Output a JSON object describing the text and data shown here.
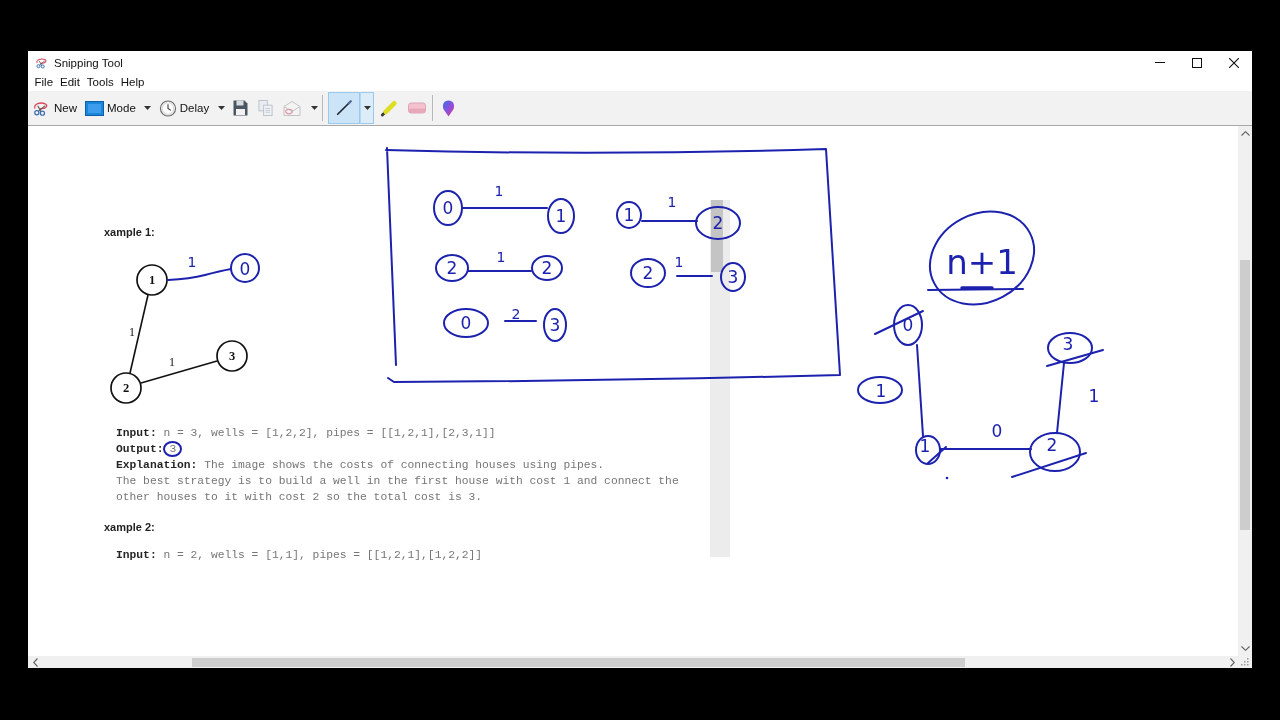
{
  "window": {
    "title": "Snipping Tool"
  },
  "menu": [
    {
      "label": "File"
    },
    {
      "label": "Edit"
    },
    {
      "label": "Tools"
    },
    {
      "label": "Help"
    }
  ],
  "toolbar": {
    "buttons": [
      {
        "kind": "new",
        "label": "New",
        "dropdown": false
      },
      {
        "kind": "mode",
        "label": "Mode",
        "dropdown": true
      },
      {
        "kind": "delay",
        "label": "Delay",
        "dropdown": true
      }
    ],
    "actions": [
      {
        "kind": "save",
        "disabled": false,
        "dropdown": false
      },
      {
        "kind": "copy",
        "disabled": true,
        "dropdown": false
      },
      {
        "kind": "send",
        "disabled": true,
        "dropdown": true
      }
    ],
    "tools": [
      {
        "kind": "pen",
        "selected": true,
        "dropdown": true
      },
      {
        "kind": "highlighter",
        "selected": false,
        "dropdown": false
      },
      {
        "kind": "eraser",
        "selected": false,
        "dropdown": false
      }
    ]
  },
  "snip": {
    "example_1": {
      "heading": "xample 1:",
      "graph": {
        "nodes": [
          {
            "label": "1"
          },
          {
            "label": "2"
          },
          {
            "label": "3"
          }
        ],
        "edges": [
          {
            "label": "1"
          },
          {
            "label": "1"
          }
        ]
      },
      "input": "**Input:** n = 3, wells = [1,2,2], pipes = [[1,2,1],[2,3,1]]",
      "output": {
        "label": "Output:",
        "value": "3",
        "circled": true
      },
      "explanation": [
        "**Explanation:** The image shows the costs of connecting houses using pipes.",
        "The best strategy is to build a well in the first house with cost 1 and connect the",
        "other houses to it with cost 2 so the total cost is 3."
      ]
    },
    "example_2": {
      "heading": "xample 2:",
      "input": "**Input:** n = 2, wells = [1,1], pipes = [[1,2,1],[1,2,2]]"
    }
  },
  "ink": {
    "example_edge": {
      "node": "0",
      "cost": "1"
    },
    "pairs": [
      {
        "from": "0",
        "to": "1",
        "cost": "1"
      },
      {
        "from": "1",
        "to": "2",
        "cost": "1"
      },
      {
        "from": "2",
        "to": "2",
        "cost": "1"
      },
      {
        "from": "2",
        "to": "3",
        "cost": "1"
      },
      {
        "from": "0",
        "to": "3",
        "cost": "2"
      }
    ],
    "note": "n+1",
    "graph": {
      "nodes": [
        {
          "label": "0",
          "crossed": true
        },
        {
          "label": "1",
          "crossed": true
        },
        {
          "label": "2",
          "crossed": true
        },
        {
          "label": "3",
          "crossed": true
        }
      ],
      "edges": [
        {
          "cost": "1",
          "circled": true
        },
        {
          "cost": "0",
          "circled": false
        },
        {
          "cost": "1",
          "circled": false
        }
      ]
    }
  }
}
